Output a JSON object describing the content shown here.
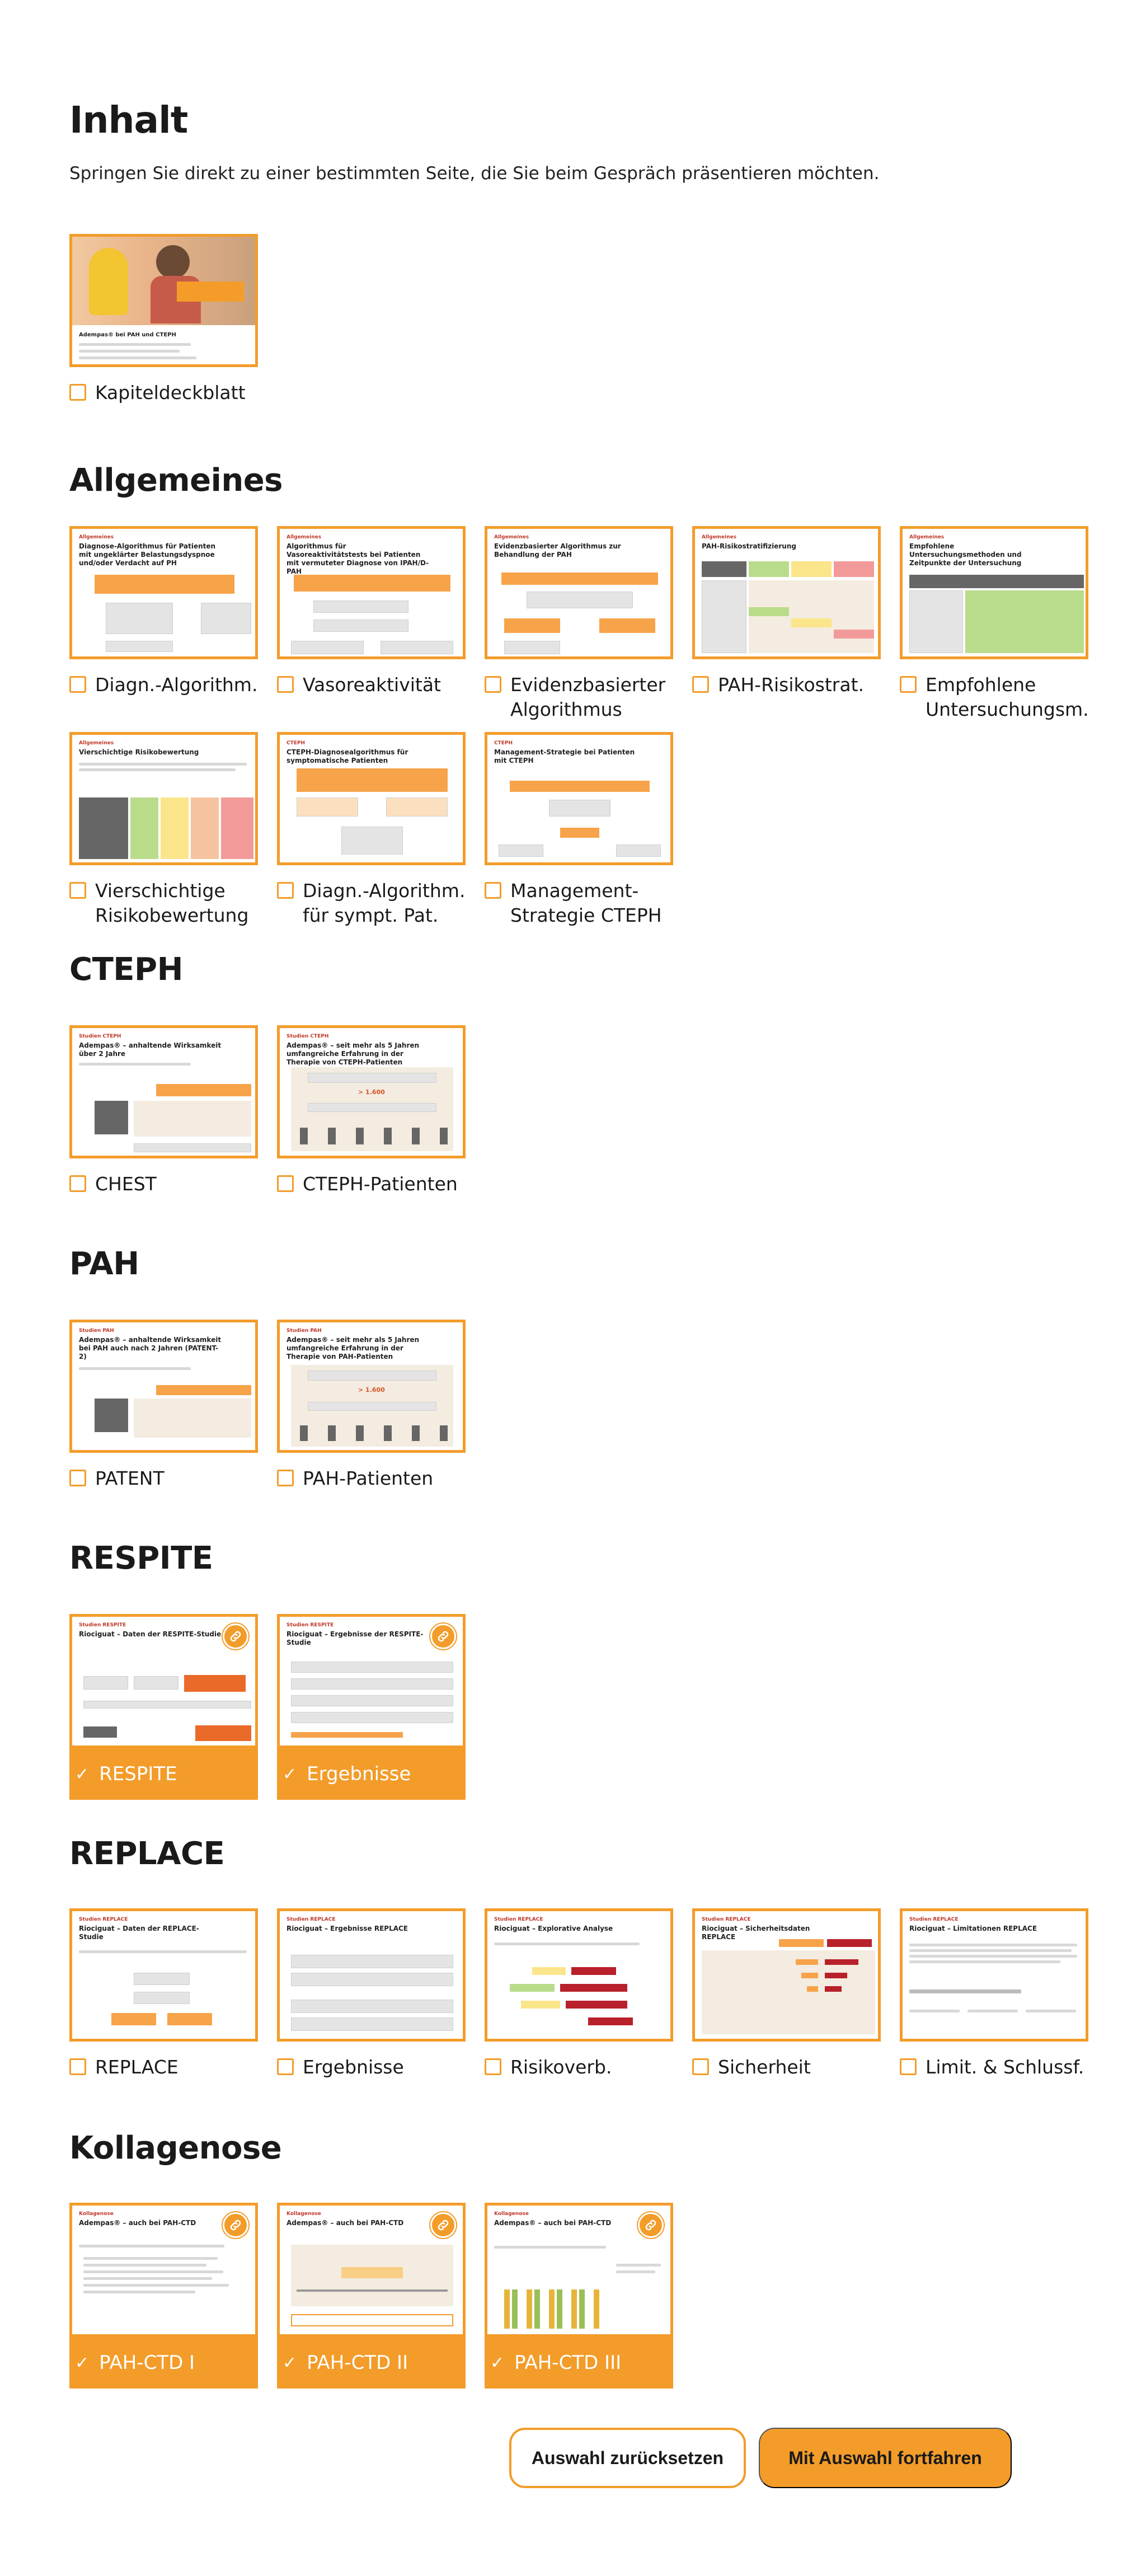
{
  "header": {
    "title": "Inhalt",
    "subtitle": "Springen Sie direkt zu einer bestimmten Seite, die Sie beim Gespräch präsentieren möchten."
  },
  "cover": {
    "label": "Kapiteldeckblatt",
    "thumb_title": "Adempas® bei PAH und CTEPH"
  },
  "sections": {
    "allgemeines": {
      "title": "Allgemeines",
      "items": [
        {
          "label": "Diagn.-Algorithm.",
          "thumb_title": "Diagnose-Algorithmus für Patienten mit ungeklärter Belastungsdyspnoe und/oder Verdacht auf PH"
        },
        {
          "label": "Vasoreaktivität",
          "thumb_title": "Algorithmus für Vasoreaktivitätstests bei Patienten mit vermuteter Diagnose von IPAH/D-PAH"
        },
        {
          "label": "Evidenzbasierter Algorithmus",
          "thumb_title": "Evidenzbasierter Algorithmus zur Behandlung der PAH"
        },
        {
          "label": "PAH-Risikostrat.",
          "thumb_title": "PAH-Risikostratifizierung"
        },
        {
          "label": "Empfohlene Untersuchungsm.",
          "thumb_title": "Empfohlene Untersuchungsmethoden und Zeitpunkte der Untersuchung"
        },
        {
          "label": "Vierschichtige Risikobewertung",
          "thumb_title": "Vierschichtige Risikobewertung"
        },
        {
          "label": "Diagn.-Algorithm. für sympt. Pat.",
          "thumb_title": "CTEPH-Diagnosealgorithmus für symptomatische Patienten"
        },
        {
          "label": "Management-Strategie CTEPH",
          "thumb_title": "Management-Strategie bei Patienten mit CTEPH"
        }
      ]
    },
    "cteph": {
      "title": "CTEPH",
      "items": [
        {
          "label": "CHEST",
          "thumb_title": "Adempas® – anhaltende Wirksamkeit über 2 Jahre"
        },
        {
          "label": "CTEPH-Patienten",
          "thumb_title": "Adempas® – seit mehr als 5 Jahren umfangreiche Erfahrung in der Therapie von CTEPH-Patienten"
        }
      ]
    },
    "pah": {
      "title": "PAH",
      "items": [
        {
          "label": "PATENT",
          "thumb_title": "Adempas® – anhaltende Wirksamkeit bei PAH auch nach 2 Jahren (PATENT-2)"
        },
        {
          "label": "PAH-Patienten",
          "thumb_title": "Adempas® – seit mehr als 5 Jahren umfangreiche Erfahrung in der Therapie von PAH-Patienten"
        }
      ]
    },
    "respite": {
      "title": "RESPITE",
      "items": [
        {
          "label": "RESPITE",
          "thumb_title": "Riociguat – Daten der RESPITE-Studie"
        },
        {
          "label": "Ergebnisse",
          "thumb_title": "Riociguat – Ergebnisse der RESPITE-Studie"
        }
      ]
    },
    "replace": {
      "title": "REPLACE",
      "items": [
        {
          "label": "REPLACE",
          "thumb_title": "Riociguat – Daten der REPLACE-Studie"
        },
        {
          "label": "Ergebnisse",
          "thumb_title": "Riociguat – Ergebnisse REPLACE"
        },
        {
          "label": "Risikoverb.",
          "thumb_title": "Riociguat – Explorative Analyse"
        },
        {
          "label": "Sicherheit",
          "thumb_title": "Riociguat – Sicherheitsdaten REPLACE"
        },
        {
          "label": "Limit. & Schlussf.",
          "thumb_title": "Riociguat – Limitationen REPLACE"
        }
      ]
    },
    "kollagenose": {
      "title": "Kollagenose",
      "items": [
        {
          "label": "PAH-CTD I",
          "thumb_title": "Adempas® – auch bei PAH-CTD"
        },
        {
          "label": "PAH-CTD II",
          "thumb_title": "Adempas® – auch bei PAH-CTD"
        },
        {
          "label": "PAH-CTD III",
          "thumb_title": "Adempas® – auch bei PAH-CTD"
        }
      ]
    }
  },
  "buttons": {
    "reset": "Auswahl zurücksetzen",
    "continue": "Mit Auswahl fortfahren"
  },
  "icons": {
    "selected": "check-icon",
    "link": "link-icon"
  },
  "colors": {
    "accent": "#f39c2a",
    "text": "#1a1a1a",
    "background": "#ffffff"
  }
}
